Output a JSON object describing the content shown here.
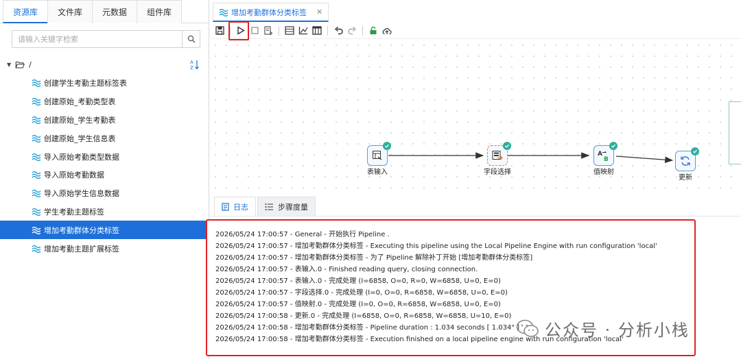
{
  "left_panel": {
    "tabs": [
      "资源库",
      "文件库",
      "元数据",
      "组件库"
    ],
    "search_placeholder": "请输入关键字检索",
    "root_label": "/",
    "tree_items": [
      "创建学生考勤主题标签表",
      "创建原始_考勤类型表",
      "创建原始_学生考勤表",
      "创建原始_学生信息表",
      "导入原始考勤类型数据",
      "导入原始考勤数据",
      "导入原始学生信息数据",
      "学生考勤主题标签",
      "增加考勤群体分类标签",
      "增加考勤主题扩展标签"
    ],
    "selected_item": "增加考勤群体分类标签"
  },
  "editor": {
    "doc_tab_title": "增加考勤群体分类标签",
    "close_glyph": "✕"
  },
  "pipeline": {
    "nodes": [
      {
        "label": "表输入",
        "icon": "table-input-icon"
      },
      {
        "label": "字段选择",
        "icon": "field-select-icon"
      },
      {
        "label": "值映射",
        "icon": "value-map-icon"
      },
      {
        "label": "更新",
        "icon": "update-icon"
      }
    ]
  },
  "log": {
    "tabs": [
      {
        "label": "日志",
        "icon": "log-icon"
      },
      {
        "label": "步骤度量",
        "icon": "metrics-icon"
      }
    ],
    "lines": [
      "2026/05/24 17:00:57 - General - 开始执行 Pipeline .",
      "2026/05/24 17:00:57 - 增加考勤群体分类标签 - Executing this pipeline using the Local Pipeline Engine with run configuration 'local'",
      "2026/05/24 17:00:57 - 增加考勤群体分类标签 - 为了 Pipeline 解除补丁开始 [增加考勤群体分类标签]",
      "2026/05/24 17:00:57 - 表输入.0 - Finished reading query, closing connection.",
      "2026/05/24 17:00:57 - 表输入.0 - 完成处理 (I=6858, O=0, R=0, W=6858, U=0, E=0)",
      "2026/05/24 17:00:57 - 字段选择.0 - 完成处理 (I=0, O=0, R=6858, W=6858, U=0, E=0)",
      "2026/05/24 17:00:57 - 值映射.0 - 完成处理 (I=0, O=0, R=6858, W=6858, U=0, E=0)",
      "2026/05/24 17:00:58 - 更新.0 - 完成处理 (I=6858, O=0, R=6858, W=6858, U=10, E=0)",
      "2026/05/24 17:00:58 - 增加考勤群体分类标签 - Pipeline duration : 1.034 seconds [  1.034\" ]",
      "2026/05/24 17:00:58 - 增加考勤群体分类标签 - Execution finished on a local pipeline engine with run configuration 'local'"
    ]
  },
  "watermark": "公众号 · 分析小栈",
  "colors": {
    "accent": "#1e6fd9",
    "highlight_box": "#e02020",
    "check": "#2eaf9c"
  }
}
